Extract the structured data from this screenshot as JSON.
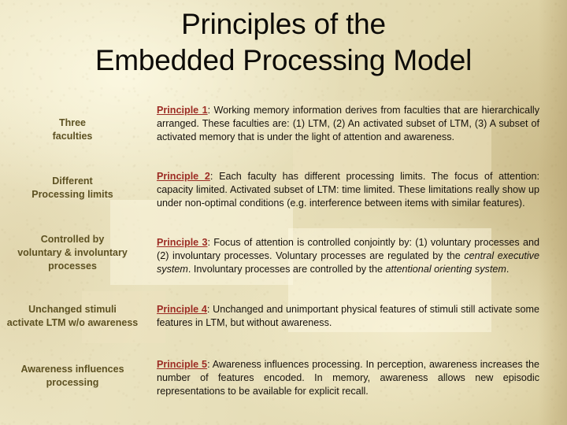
{
  "slide": {
    "title": "Principles of the\nEmbedded Processing Model",
    "background_color": "#e9e1bd",
    "label_color": "#5d5122",
    "principle_label_color": "#9c2c24",
    "body_text_color": "#17120c",
    "title_color": "#0d0b08"
  },
  "rows": [
    {
      "label": "Three\nfaculties",
      "principle": "Principle 1",
      "body_before_italic": ":  Working memory information derives from faculties that are hierarchically arranged.   These faculties are: (1) LTM, (2) An activated subset of LTM, (3) A subset of activated memory that is under the light of attention and awareness.",
      "italic": "",
      "body_after_italic": ""
    },
    {
      "label": "Different\nProcessing limits",
      "principle": "Principle 2",
      "body_before_italic": ":   Each faculty has different processing limits.   The focus of attention:  capacity limited.  Activated subset of LTM:  time limited.  These limitations really show up under non-optimal conditions (e.g. interference between items with similar features).",
      "italic": "",
      "body_after_italic": ""
    },
    {
      "label": "Controlled by\nvoluntary & involuntary\nprocesses",
      "principle": "Principle 3",
      "body_before_italic": ":   Focus of attention is controlled conjointly by:  (1) voluntary processes and (2) involuntary processes.    Voluntary processes are regulated by the ",
      "italic": "central executive system",
      "body_after_italic": ".   Involuntary processes are controlled by the ",
      "italic2": "attentional orienting system",
      "body_end": "."
    },
    {
      "label": "Unchanged stimuli\nactivate LTM w/o awareness",
      "principle": "Principle 4",
      "body_before_italic": ":   Unchanged and unimportant physical features of stimuli still activate some features in LTM, but without awareness.",
      "italic": "",
      "body_after_italic": ""
    },
    {
      "label": "Awareness influences\nprocessing",
      "principle": "Principle 5",
      "body_before_italic": ":  Awareness influences processing. In perception, awareness increases the number of features encoded.  In memory, awareness allows new episodic representations to be available for explicit recall.",
      "italic": "",
      "body_after_italic": ""
    }
  ]
}
